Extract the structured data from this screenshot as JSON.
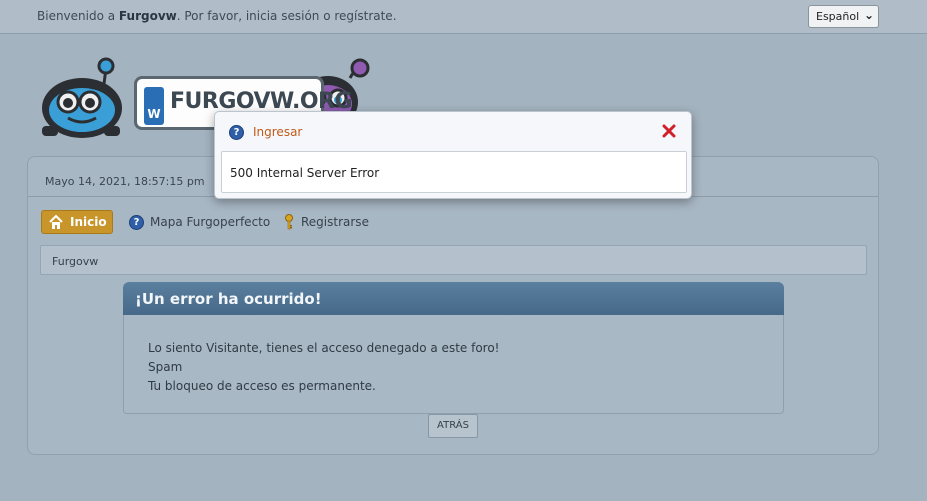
{
  "topbar": {
    "welcome_prefix": "Bienvenido a ",
    "site_name": "Furgovw",
    "welcome_suffix": ". Por favor, inicia sesión o regístrate.",
    "language": "Español"
  },
  "logo": {
    "text": "FURGOVW.ORG",
    "badge": "W"
  },
  "header": {
    "date": "Mayo 14, 2021, 18:57:15 pm"
  },
  "nav": {
    "items": [
      {
        "label": "Inicio",
        "icon": "home-icon"
      },
      {
        "label": "Mapa Furgoperfecto",
        "icon": "help-icon"
      },
      {
        "label": "Registrarse",
        "icon": "key-icon"
      }
    ]
  },
  "breadcrumb": "Furgovw",
  "error": {
    "title": "¡Un error ha ocurrido!",
    "lines": [
      "Lo siento Visitante, tienes el acceso denegado a este foro!",
      "Spam",
      "Tu bloqueo de acceso es permanente."
    ],
    "back_label": "ATRÁS"
  },
  "modal": {
    "title": "Ingresar",
    "message": "500 Internal Server Error"
  },
  "colors": {
    "accent_orange": "#c8952a",
    "modal_title": "#c05a1a",
    "error_header": "#4f7392",
    "close_red": "#d0202a"
  }
}
